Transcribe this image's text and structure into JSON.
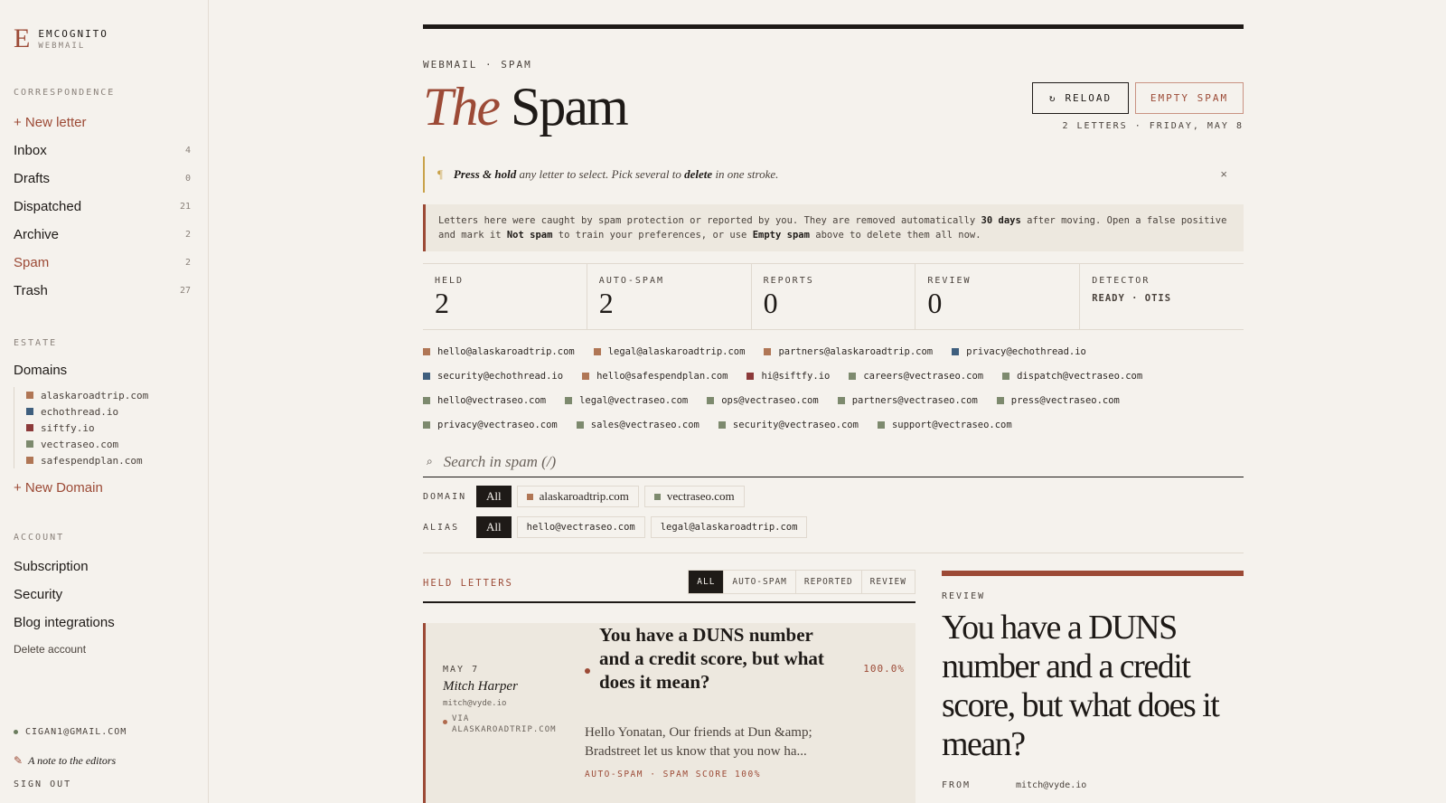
{
  "brand": {
    "mark": "E",
    "name": "EMCOGNITO",
    "sub": "WEBMAIL"
  },
  "sidebar": {
    "correspondence_label": "CORRESPONDENCE",
    "new_letter": "+ New letter",
    "nav": [
      {
        "label": "Inbox",
        "count": "4"
      },
      {
        "label": "Drafts",
        "count": "0"
      },
      {
        "label": "Dispatched",
        "count": "21"
      },
      {
        "label": "Archive",
        "count": "2"
      },
      {
        "label": "Spam",
        "count": "2"
      },
      {
        "label": "Trash",
        "count": "27"
      }
    ],
    "estate_label": "ESTATE",
    "domains_label": "Domains",
    "domains": [
      {
        "name": "alaskaroadtrip.com",
        "color": "#b07655"
      },
      {
        "name": "echothread.io",
        "color": "#3f5f7e"
      },
      {
        "name": "siftfy.io",
        "color": "#8c3a3a"
      },
      {
        "name": "vectraseo.com",
        "color": "#7d8a6e"
      },
      {
        "name": "safespendplan.com",
        "color": "#b07655"
      }
    ],
    "new_domain": "+ New Domain",
    "account_label": "ACCOUNT",
    "account": [
      "Subscription",
      "Security",
      "Blog integrations"
    ],
    "delete_account": "Delete account",
    "user_email": "CIGAN1@GMAIL.COM",
    "note": "A note to the editors",
    "note_icon": "✎",
    "sign_out": "SIGN OUT"
  },
  "header": {
    "breadcrumb": "WEBMAIL · SPAM",
    "title_italic": "The",
    "title_rest": "Spam",
    "reload_icon": "↻",
    "reload_label": "RELOAD",
    "empty_label": "EMPTY SPAM",
    "subcount": "2 LETTERS · FRIDAY, MAY 8"
  },
  "hint": {
    "pilcrow": "¶",
    "bold1": "Press & hold",
    "text1": " any letter to select. Pick several to ",
    "bold2": "delete",
    "text2": " in one stroke.",
    "close": "×"
  },
  "info": {
    "t1": "Letters here were caught by spam protection or reported by you. They are removed automatically ",
    "b1": "30 days",
    "t2": " after moving. Open a false positive and mark it ",
    "b2": "Not spam",
    "t3": " to train your preferences, or use ",
    "b3": "Empty spam",
    "t4": " above to delete them all now."
  },
  "stats": [
    {
      "label": "HELD",
      "value": "2"
    },
    {
      "label": "AUTO-SPAM",
      "value": "2"
    },
    {
      "label": "REPORTS",
      "value": "0"
    },
    {
      "label": "REVIEW",
      "value": "0"
    },
    {
      "label": "DETECTOR",
      "text": "READY · OTIS"
    }
  ],
  "aliases": [
    [
      {
        "email": "hello@alaskaroadtrip.com",
        "color": "#b07655"
      },
      {
        "email": "legal@alaskaroadtrip.com",
        "color": "#b07655"
      },
      {
        "email": "partners@alaskaroadtrip.com",
        "color": "#b07655"
      },
      {
        "email": "privacy@echothread.io",
        "color": "#3f5f7e"
      }
    ],
    [
      {
        "email": "security@echothread.io",
        "color": "#3f5f7e"
      },
      {
        "email": "hello@safespendplan.com",
        "color": "#b07655"
      },
      {
        "email": "hi@siftfy.io",
        "color": "#8c3a3a"
      },
      {
        "email": "careers@vectraseo.com",
        "color": "#7d8a6e"
      },
      {
        "email": "dispatch@vectraseo.com",
        "color": "#7d8a6e"
      }
    ],
    [
      {
        "email": "hello@vectraseo.com",
        "color": "#7d8a6e"
      },
      {
        "email": "legal@vectraseo.com",
        "color": "#7d8a6e"
      },
      {
        "email": "ops@vectraseo.com",
        "color": "#7d8a6e"
      },
      {
        "email": "partners@vectraseo.com",
        "color": "#7d8a6e"
      },
      {
        "email": "press@vectraseo.com",
        "color": "#7d8a6e"
      }
    ],
    [
      {
        "email": "privacy@vectraseo.com",
        "color": "#7d8a6e"
      },
      {
        "email": "sales@vectraseo.com",
        "color": "#7d8a6e"
      },
      {
        "email": "security@vectraseo.com",
        "color": "#7d8a6e"
      },
      {
        "email": "support@vectraseo.com",
        "color": "#7d8a6e"
      }
    ]
  ],
  "search": {
    "icon": "⌕",
    "placeholder": "Search in spam (/)"
  },
  "filters": {
    "domain_label": "DOMAIN",
    "domain_all": "All",
    "domain_chips": [
      {
        "name": "alaskaroadtrip.com",
        "color": "#b07655"
      },
      {
        "name": "vectraseo.com",
        "color": "#7d8a6e"
      }
    ],
    "alias_label": "ALIAS",
    "alias_all": "All",
    "alias_chips": [
      "hello@vectraseo.com",
      "legal@alaskaroadtrip.com"
    ]
  },
  "held": {
    "label": "HELD LETTERS",
    "tabs": [
      "ALL",
      "AUTO-SPAM",
      "REPORTED",
      "REVIEW"
    ]
  },
  "letter": {
    "date": "MAY 7",
    "from": "Mitch Harper",
    "email": "mitch@vyde.io",
    "via_label": "VIA",
    "via_domain": "ALASKAROADTRIP.COM",
    "subject": "You have a DUNS number and a credit score, but what does it mean?",
    "score": "100.0%",
    "snippet": "Hello Yonatan, Our friends at Dun &amp; Bradstreet let us know that you now ha...",
    "meta": "AUTO-SPAM · SPAM SCORE 100%"
  },
  "review": {
    "label": "REVIEW",
    "subject": "You have a DUNS number and a credit score, but what does it mean?",
    "from_label": "FROM",
    "from_value": "mitch@vyde.io"
  },
  "colors": {
    "accent": "#9c4a36",
    "ink": "#1e1a17",
    "paper": "#f5f2ed",
    "gold": "#c9a24a"
  }
}
